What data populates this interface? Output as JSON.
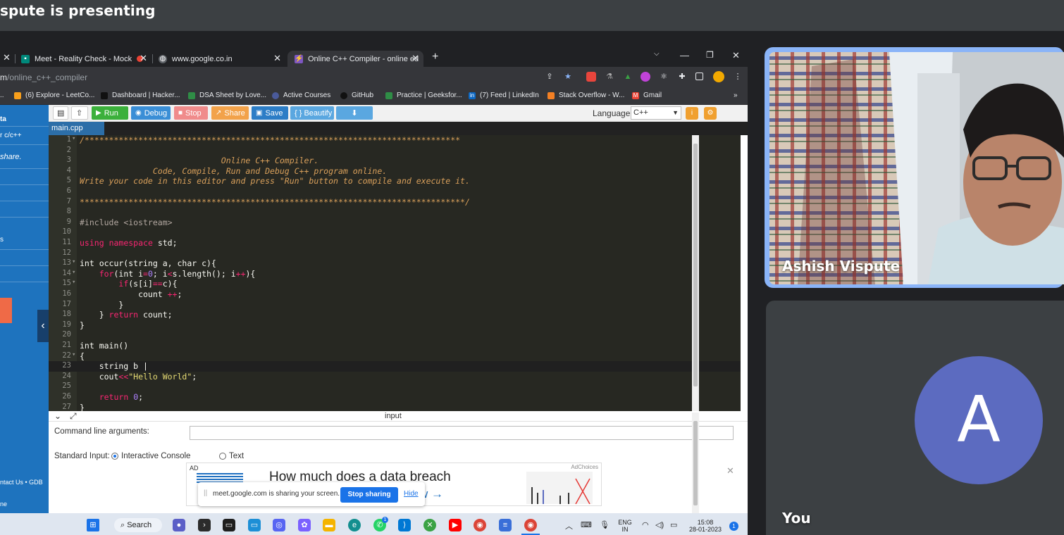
{
  "meet": {
    "presenting_title": "spute is presenting",
    "participant_name": "Ashish Vispute",
    "self_label": "You",
    "self_avatar_letter": "A"
  },
  "browser": {
    "tabs": [
      {
        "label": "Meet - Reality Check - Mock",
        "favicon": "google-meet-icon",
        "active": false
      },
      {
        "label": "www.google.co.in",
        "favicon": "globe-icon",
        "active": false
      },
      {
        "label": "Online C++ Compiler - online ed",
        "favicon": "bolt-icon",
        "active": true
      }
    ],
    "new_tab": "+",
    "url_prefix": "m",
    "url_path": "/online_c++_compiler",
    "bookmarks": [
      {
        "label": "(6) Explore - LeetCo...",
        "icon": "leetcode-icon",
        "color": "#f89f1b"
      },
      {
        "label": "Dashboard | Hacker...",
        "icon": "hackerrank-icon",
        "color": "#111111"
      },
      {
        "label": "DSA Sheet by Love...",
        "icon": "gfg-icon",
        "color": "#2f8d46"
      },
      {
        "label": "Active Courses",
        "icon": "course-icon",
        "color": "#4a5a9a"
      },
      {
        "label": "GitHub",
        "icon": "github-icon",
        "color": "#111111"
      },
      {
        "label": "Practice | Geeksfor...",
        "icon": "gfg-icon",
        "color": "#2f8d46"
      },
      {
        "label": "(7) Feed | LinkedIn",
        "icon": "linkedin-icon",
        "color": "#0a66c2"
      },
      {
        "label": "Stack Overflow - W...",
        "icon": "stackoverflow-icon",
        "color": "#f48024"
      },
      {
        "label": "Gmail",
        "icon": "gmail-icon",
        "color": "#ea4335"
      }
    ],
    "more_bookmarks": "»"
  },
  "site": {
    "nav_snippets": [
      "ta",
      "r c/c++",
      "share.",
      "s",
      "ntact Us • GDB",
      "ne"
    ],
    "toolbar": [
      {
        "label": "Run",
        "icon": "play-icon",
        "color": "#3bb03b"
      },
      {
        "label": "Debug",
        "icon": "debug-icon",
        "color": "#3a8ed6"
      },
      {
        "label": "Stop",
        "icon": "stop-icon",
        "color": "#f08b8b"
      },
      {
        "label": "Share",
        "icon": "share-icon",
        "color": "#f2a24a"
      },
      {
        "label": "Save",
        "icon": "save-icon",
        "color": "#2c7dc6"
      },
      {
        "label": "{ } Beautify",
        "icon": "",
        "color": "#5aa7e0"
      }
    ],
    "language_label": "Language",
    "language_value": "C++",
    "file_tab": "main.cpp",
    "io_title": "input",
    "cmd_label": "Command line arguments:",
    "stdin_label": "Standard Input:",
    "radio_interactive": "Interactive Console",
    "radio_text": "Text",
    "ad": {
      "label": "AD",
      "choices": "AdChoices",
      "headline": "How much does a data breach",
      "sub": "w →"
    },
    "share_notice": {
      "text": "meet.google.com is sharing your screen.",
      "stop": "Stop sharing",
      "hide": "Hide"
    }
  },
  "code": [
    {
      "n": "1",
      "fold": true,
      "html": "<span class=\"cmt\">/*****************************************************************************</span>"
    },
    {
      "n": "2",
      "html": ""
    },
    {
      "n": "3",
      "html": "<span class=\"cmt\">                             Online C++ Compiler.</span>"
    },
    {
      "n": "4",
      "html": "<span class=\"cmt\">               Code, Compile, Run and Debug C++ program online.</span>"
    },
    {
      "n": "5",
      "html": "<span class=\"cmt\">Write your code in this editor and press \"Run\" button to compile and execute it.</span>"
    },
    {
      "n": "6",
      "html": ""
    },
    {
      "n": "7",
      "html": "<span class=\"cmt\">*******************************************************************************/</span>"
    },
    {
      "n": "8",
      "html": ""
    },
    {
      "n": "9",
      "html": "<span class=\"pre\">#include </span><span class=\"pre\">&lt;iostream&gt;</span>"
    },
    {
      "n": "10",
      "html": ""
    },
    {
      "n": "11",
      "html": "<span class=\"kw\">using</span> <span class=\"kw\">namespace</span> <span class=\"plain\">std;</span>"
    },
    {
      "n": "12",
      "html": ""
    },
    {
      "n": "13",
      "fold": true,
      "html": "<span class=\"plain\">int occur(string a, char c){</span>"
    },
    {
      "n": "14",
      "fold": true,
      "html": "<span class=\"plain\">    </span><span class=\"kw\">for</span><span class=\"plain\">(int i</span><span class=\"kw\">=</span><span class=\"num\">0</span><span class=\"plain\">; i</span><span class=\"kw\">&lt;</span><span class=\"plain\">s.length(); i</span><span class=\"kw\">++</span><span class=\"plain\">){</span>"
    },
    {
      "n": "15",
      "fold": true,
      "html": "<span class=\"plain\">        </span><span class=\"kw\">if</span><span class=\"plain\">(s[i]</span><span class=\"kw\">==</span><span class=\"plain\">c){</span>"
    },
    {
      "n": "16",
      "html": "<span class=\"plain\">            count </span><span class=\"kw\">++</span><span class=\"plain\">;</span>"
    },
    {
      "n": "17",
      "html": "<span class=\"plain\">        }</span>"
    },
    {
      "n": "18",
      "html": "<span class=\"plain\">    } </span><span class=\"kw\">return</span><span class=\"plain\"> count;</span>"
    },
    {
      "n": "19",
      "html": "<span class=\"plain\">}</span>"
    },
    {
      "n": "20",
      "html": ""
    },
    {
      "n": "21",
      "html": "<span class=\"plain\">int main()</span>"
    },
    {
      "n": "22",
      "fold": true,
      "html": "<span class=\"plain\">{</span>"
    },
    {
      "n": "23",
      "cur": true,
      "html": "<span class=\"plain\">    string b |</span>"
    },
    {
      "n": "24",
      "html": "<span class=\"plain\">    cout</span><span class=\"kw\">&lt;&lt;</span><span class=\"str\">\"Hello World\"</span><span class=\"plain\">;</span>"
    },
    {
      "n": "25",
      "html": ""
    },
    {
      "n": "26",
      "html": "<span class=\"plain\">    </span><span class=\"kw\">return</span><span class=\"plain\"> </span><span class=\"num\">0</span><span class=\"plain\">;</span>"
    },
    {
      "n": "27",
      "html": "<span class=\"plain\">}</span>"
    }
  ],
  "taskbar": {
    "search_label": "Search",
    "lang_top": "ENG",
    "lang_bottom": "IN",
    "time": "15:08",
    "date": "28-01-2023",
    "notifications": "1",
    "whatsapp_badge": "1",
    "apps": [
      {
        "icon": "windows-start-icon",
        "color": "#1a73e8"
      },
      {
        "icon": "meet-app-icon",
        "color": "#5b5fc7"
      },
      {
        "icon": "terminal-icon",
        "color": "#2b2b2b"
      },
      {
        "icon": "console-icon",
        "color": "#1e1e1e"
      },
      {
        "icon": "desktop-icon",
        "color": "#1d8fd6"
      },
      {
        "icon": "discord-icon",
        "color": "#5865f2"
      },
      {
        "icon": "copilot-icon",
        "color": "#7b61ff"
      },
      {
        "icon": "file-explorer-icon",
        "color": "#f4b400"
      },
      {
        "icon": "edge-icon",
        "color": "#138f8f"
      },
      {
        "icon": "whatsapp-icon",
        "color": "#25d366"
      },
      {
        "icon": "vscode-icon",
        "color": "#0078d4"
      },
      {
        "icon": "xbox-icon",
        "color": "#3aa245"
      },
      {
        "icon": "youtube-icon",
        "color": "#ff0000"
      },
      {
        "icon": "chrome-icon",
        "color": "#db4437"
      },
      {
        "icon": "notepad-icon",
        "color": "#3a6fd8"
      },
      {
        "icon": "chrome-active-icon",
        "color": "#db4437"
      }
    ]
  }
}
